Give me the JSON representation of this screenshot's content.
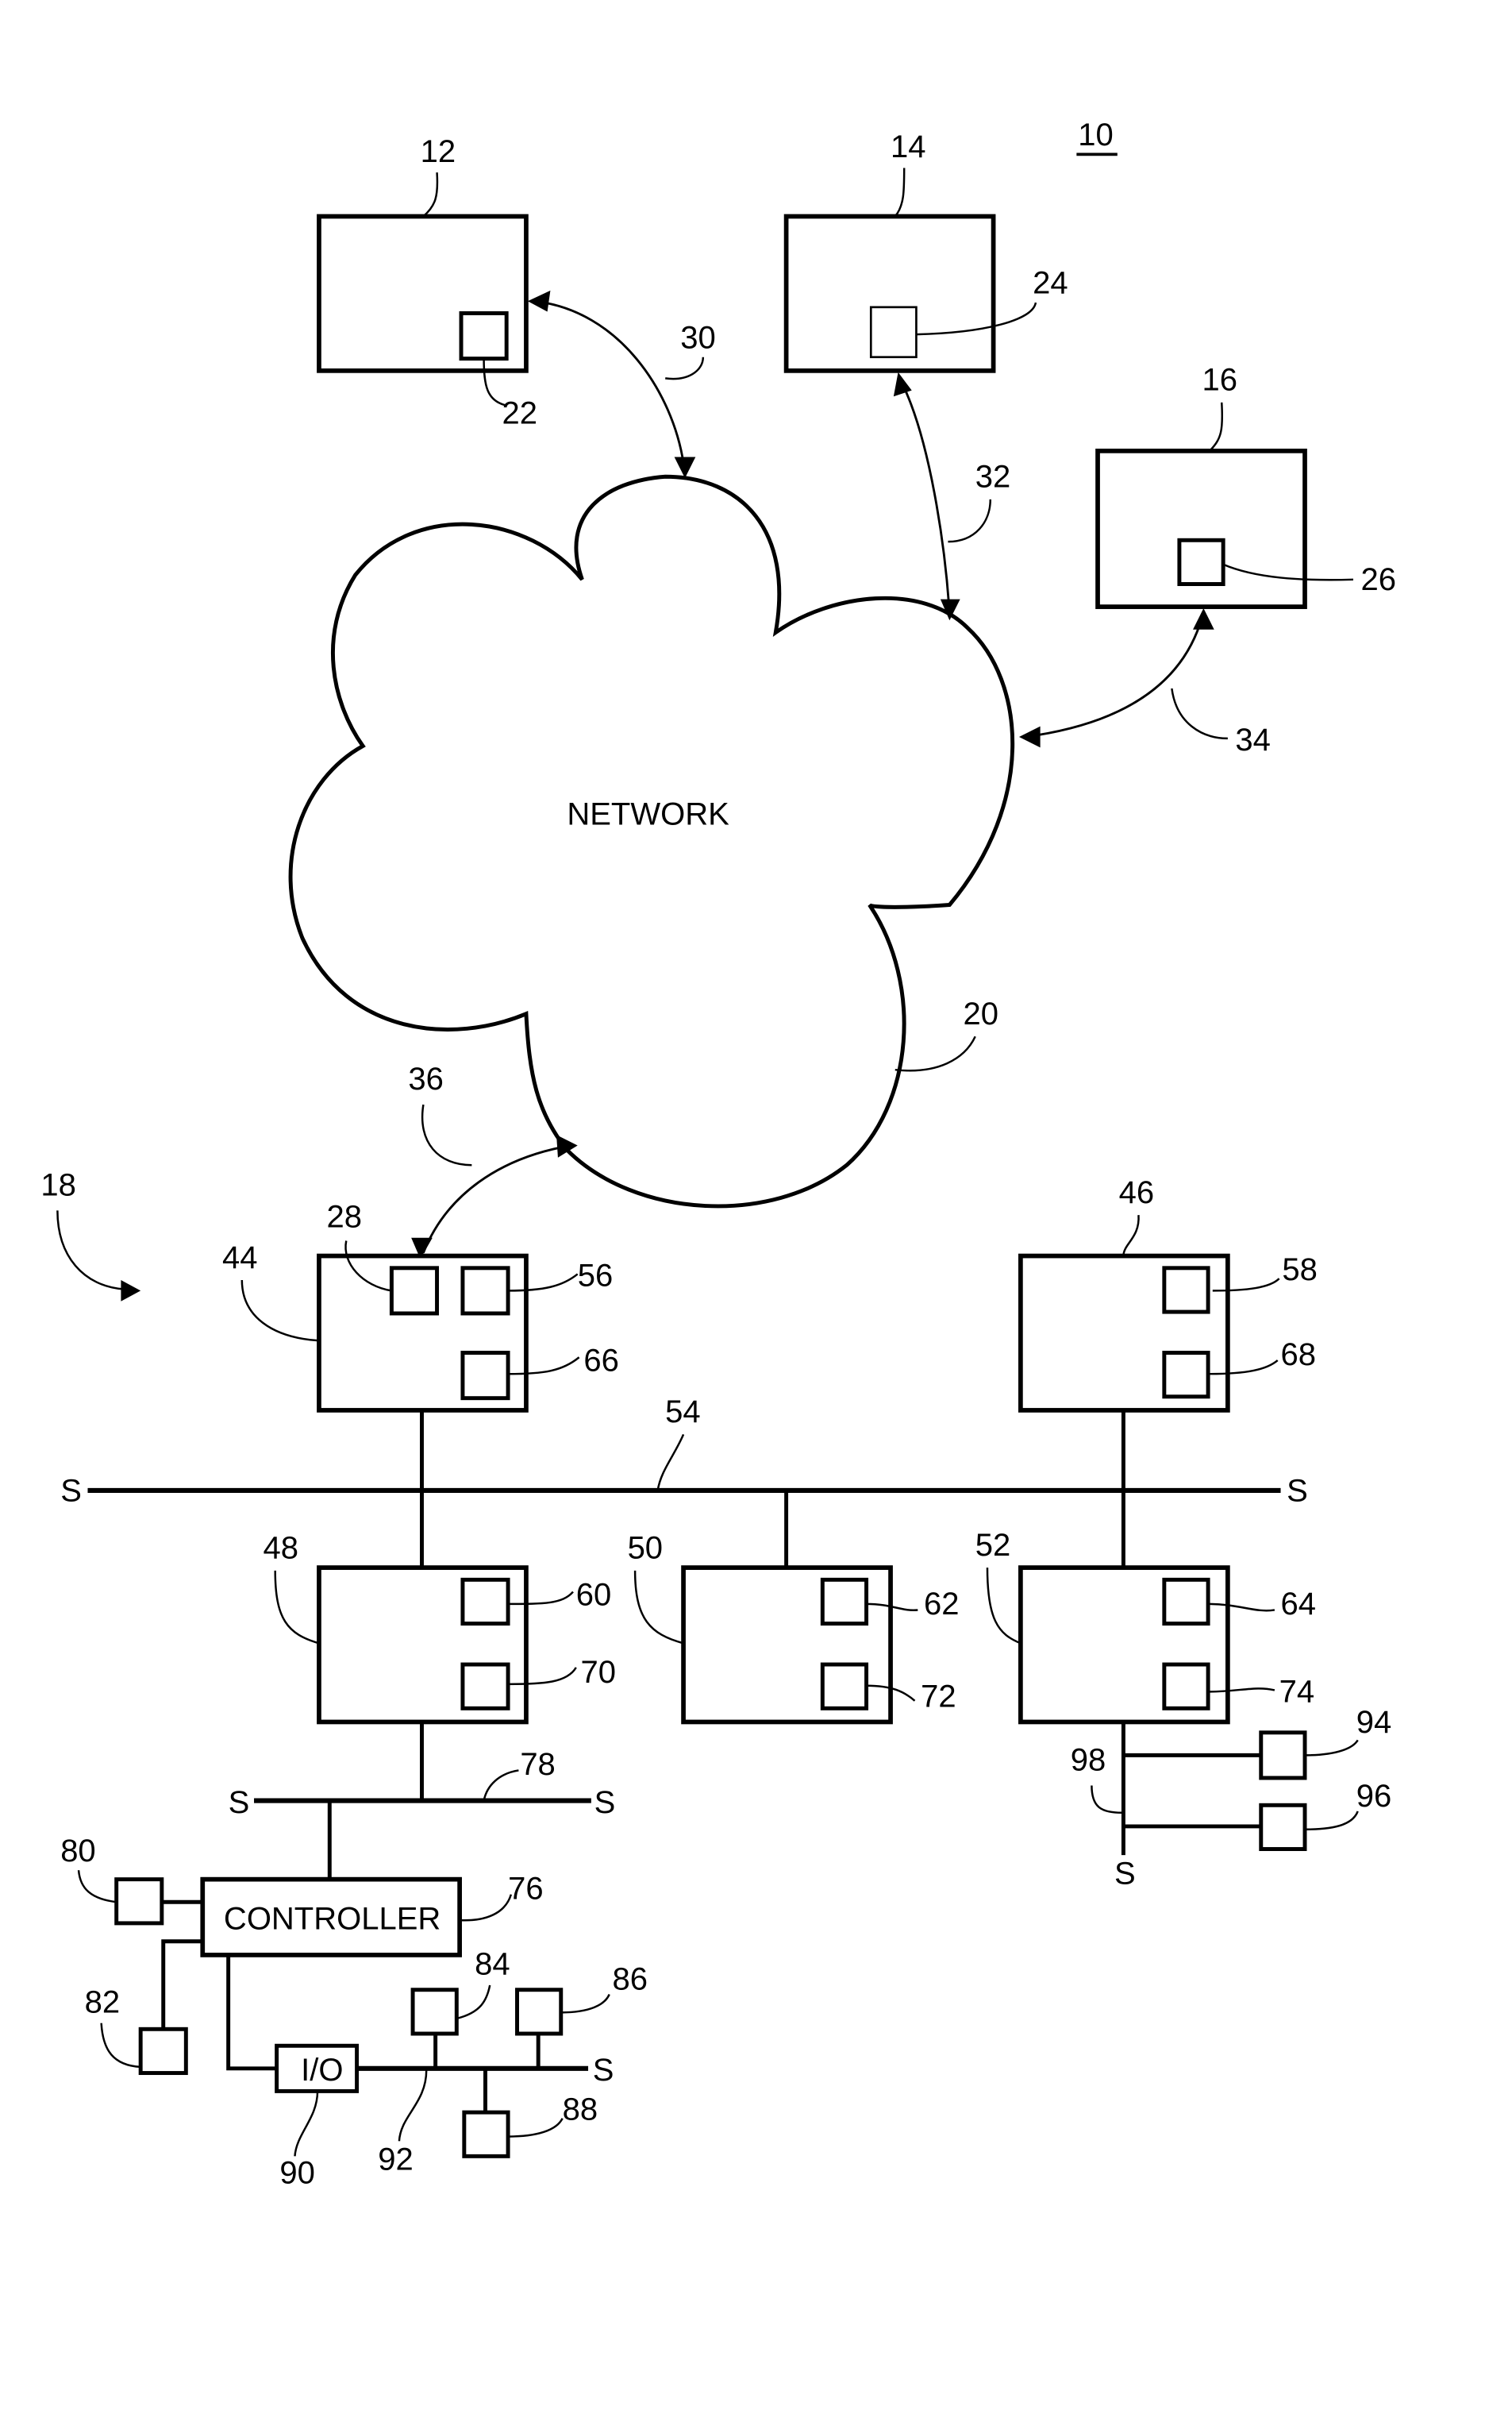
{
  "figure": {
    "figure_ref": "10",
    "network_label": "NETWORK",
    "controller_label": "CONTROLLER",
    "io_label": "I/O",
    "terminator_label": "S"
  },
  "refs": {
    "r12": "12",
    "r14": "14",
    "r16": "16",
    "r18": "18",
    "r20": "20",
    "r22": "22",
    "r24": "24",
    "r26": "26",
    "r28": "28",
    "r30": "30",
    "r32": "32",
    "r34": "34",
    "r36": "36",
    "r44": "44",
    "r46": "46",
    "r48": "48",
    "r50": "50",
    "r52": "52",
    "r54": "54",
    "r56": "56",
    "r58": "58",
    "r60": "60",
    "r62": "62",
    "r64": "64",
    "r66": "66",
    "r68": "68",
    "r70": "70",
    "r72": "72",
    "r74": "74",
    "r76": "76",
    "r78": "78",
    "r80": "80",
    "r82": "82",
    "r84": "84",
    "r86": "86",
    "r88": "88",
    "r90": "90",
    "r92": "92",
    "r94": "94",
    "r96": "96",
    "r98": "98"
  }
}
